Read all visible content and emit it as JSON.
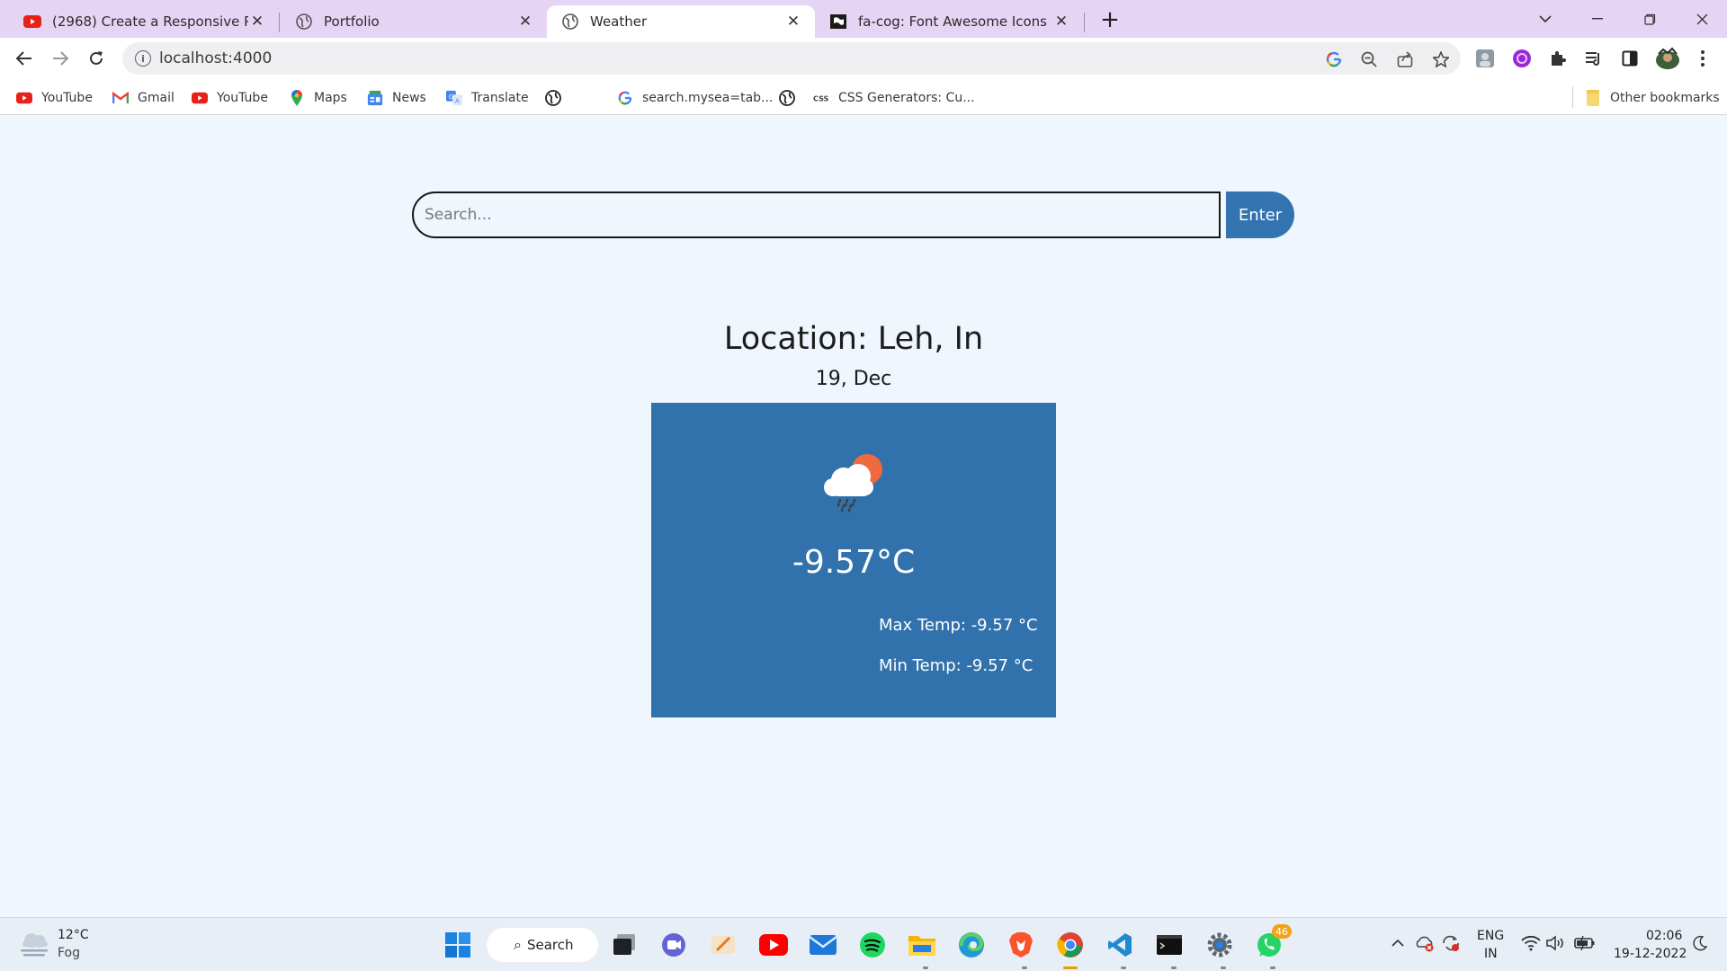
{
  "browser": {
    "tabs": [
      {
        "title": "(2968) Create a Responsive Perso",
        "icon": "youtube-icon"
      },
      {
        "title": "Portfolio",
        "icon": "globe-icon"
      },
      {
        "title": "Weather",
        "icon": "globe-icon",
        "active": true
      },
      {
        "title": "fa-cog: Font Awesome Icons",
        "icon": "font-awesome-flag-icon"
      }
    ],
    "address": "localhost:4000",
    "bookmarks": [
      {
        "label": "YouTube",
        "icon": "youtube-icon"
      },
      {
        "label": "Gmail",
        "icon": "gmail-icon"
      },
      {
        "label": "YouTube",
        "icon": "youtube-icon"
      },
      {
        "label": "Maps",
        "icon": "maps-icon"
      },
      {
        "label": "News",
        "icon": "news-icon"
      },
      {
        "label": "Translate",
        "icon": "translate-icon"
      },
      {
        "label": "",
        "icon": "globe-icon"
      },
      {
        "label": "search.mysea=tab...",
        "icon": "google-icon"
      },
      {
        "label": "",
        "icon": "globe-icon"
      },
      {
        "label": "CSS Generators: Cu...",
        "icon": "css-icon"
      }
    ],
    "other_bookmarks": "Other bookmarks"
  },
  "app": {
    "search_placeholder": "Search...",
    "enter_label": "Enter",
    "location": "Location: Leh, In",
    "date": "19, Dec",
    "weather_icon": "cloud-rain-sun-icon",
    "temperature": "-9.57°C",
    "max_temp": "Max Temp: -9.57 °C",
    "min_temp": "Min Temp: -9.57 °C"
  },
  "taskbar": {
    "weather_temp": "12°C",
    "weather_cond": "Fog",
    "search_label": "Search",
    "whatsapp_badge": "46",
    "lang_top": "ENG",
    "lang_bottom": "IN",
    "time": "02:06",
    "date": "19-12-2022"
  },
  "colors": {
    "accent": "#3273b0",
    "page_bg": "#eff6fd",
    "tabstrip_bg": "#e6d4f4"
  }
}
